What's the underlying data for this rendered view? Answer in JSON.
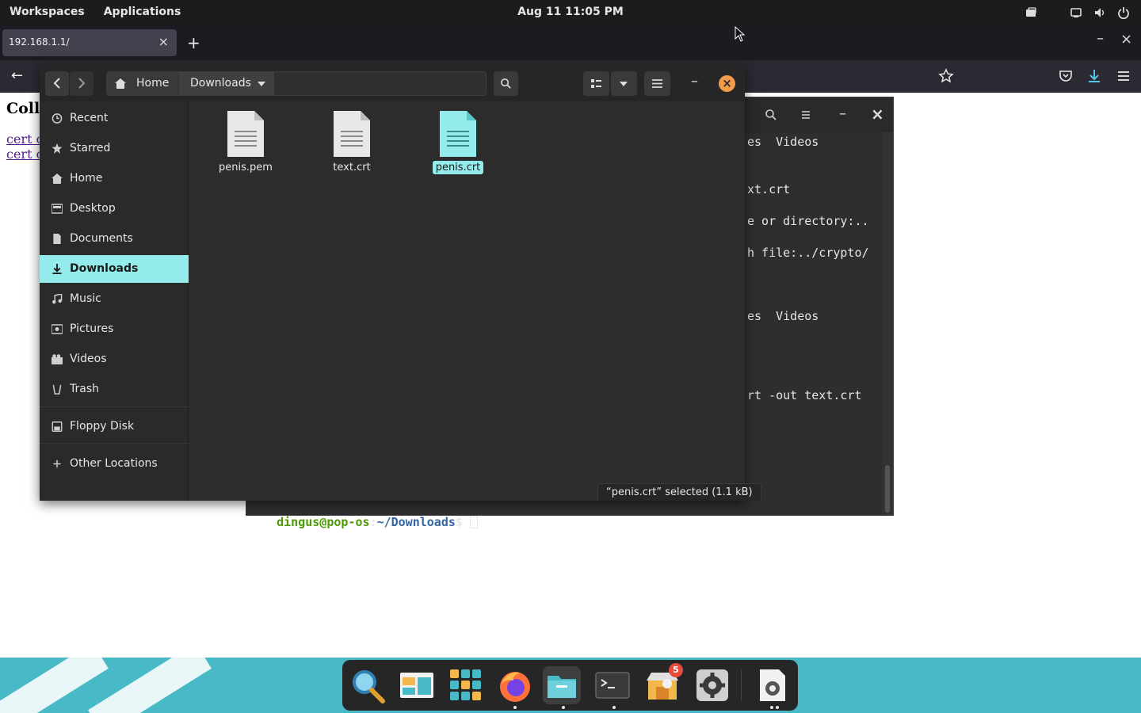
{
  "top_panel": {
    "workspaces": "Workspaces",
    "applications": "Applications",
    "clock": "Aug 11  11:05 PM"
  },
  "browser": {
    "tab_title": "192.168.1.1/",
    "tab_close": "×",
    "new_tab": "+",
    "minimize": "–",
    "close": "×",
    "back": "←",
    "page_title_partial": "Coll",
    "links_partial": [
      "cert c",
      "cert c"
    ]
  },
  "terminal": {
    "lines": [
      "es  Videos",
      "xt.crt",
      "e or directory:..",
      "h file:../crypto/",
      "es  Videos",
      "rt -out text.crt"
    ],
    "prompt_user": "dingus@pop-os",
    "prompt_sep": ":",
    "prompt_path": "~/Downloads",
    "prompt_symbol": "$ ",
    "minimize": "–",
    "close": "×"
  },
  "files": {
    "breadcrumb_home": "Home",
    "breadcrumb_current": "Downloads",
    "minimize": "–",
    "close": "×",
    "sidebar": [
      {
        "label": "Recent",
        "icon": "clock-icon"
      },
      {
        "label": "Starred",
        "icon": "star-icon"
      },
      {
        "label": "Home",
        "icon": "home-icon"
      },
      {
        "label": "Desktop",
        "icon": "desktop-icon"
      },
      {
        "label": "Documents",
        "icon": "document-icon"
      },
      {
        "label": "Downloads",
        "icon": "download-icon",
        "active": true
      },
      {
        "label": "Music",
        "icon": "music-icon"
      },
      {
        "label": "Pictures",
        "icon": "picture-icon"
      },
      {
        "label": "Videos",
        "icon": "video-icon"
      },
      {
        "label": "Trash",
        "icon": "trash-icon"
      },
      {
        "label": "Floppy Disk",
        "icon": "drive-icon"
      },
      {
        "label": "Other Locations",
        "icon": "plus-icon"
      }
    ],
    "items": [
      {
        "name": "penis.pem"
      },
      {
        "name": "text.crt"
      },
      {
        "name": "penis.crt",
        "selected": true
      }
    ],
    "status": "“penis.crt” selected  (1.1 kB)"
  },
  "dock": {
    "apps": [
      "search-app",
      "files-overview-app",
      "app-grid",
      "firefox-app",
      "files-app",
      "terminal-app",
      "pop-shop-app",
      "settings-app",
      "system-settings-app"
    ],
    "pop_shop_badge": "5"
  },
  "colors": {
    "accent": "#94ebeb",
    "close_orange": "#f29b4a",
    "prompt_green": "#4e9a06",
    "prompt_blue": "#3465a4",
    "wallpaper": "#48b9c7"
  }
}
